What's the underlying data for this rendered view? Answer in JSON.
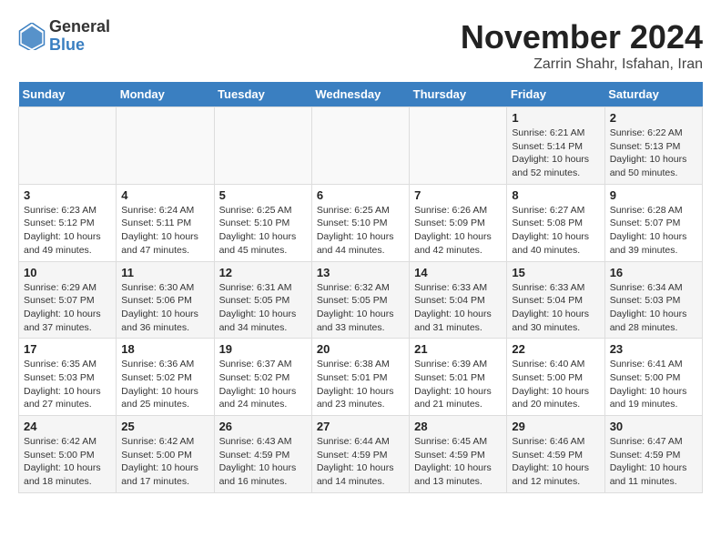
{
  "logo": {
    "general": "General",
    "blue": "Blue"
  },
  "header": {
    "month": "November 2024",
    "location": "Zarrin Shahr, Isfahan, Iran"
  },
  "weekdays": [
    "Sunday",
    "Monday",
    "Tuesday",
    "Wednesday",
    "Thursday",
    "Friday",
    "Saturday"
  ],
  "weeks": [
    [
      {
        "day": "",
        "detail": ""
      },
      {
        "day": "",
        "detail": ""
      },
      {
        "day": "",
        "detail": ""
      },
      {
        "day": "",
        "detail": ""
      },
      {
        "day": "",
        "detail": ""
      },
      {
        "day": "1",
        "detail": "Sunrise: 6:21 AM\nSunset: 5:14 PM\nDaylight: 10 hours\nand 52 minutes."
      },
      {
        "day": "2",
        "detail": "Sunrise: 6:22 AM\nSunset: 5:13 PM\nDaylight: 10 hours\nand 50 minutes."
      }
    ],
    [
      {
        "day": "3",
        "detail": "Sunrise: 6:23 AM\nSunset: 5:12 PM\nDaylight: 10 hours\nand 49 minutes."
      },
      {
        "day": "4",
        "detail": "Sunrise: 6:24 AM\nSunset: 5:11 PM\nDaylight: 10 hours\nand 47 minutes."
      },
      {
        "day": "5",
        "detail": "Sunrise: 6:25 AM\nSunset: 5:10 PM\nDaylight: 10 hours\nand 45 minutes."
      },
      {
        "day": "6",
        "detail": "Sunrise: 6:25 AM\nSunset: 5:10 PM\nDaylight: 10 hours\nand 44 minutes."
      },
      {
        "day": "7",
        "detail": "Sunrise: 6:26 AM\nSunset: 5:09 PM\nDaylight: 10 hours\nand 42 minutes."
      },
      {
        "day": "8",
        "detail": "Sunrise: 6:27 AM\nSunset: 5:08 PM\nDaylight: 10 hours\nand 40 minutes."
      },
      {
        "day": "9",
        "detail": "Sunrise: 6:28 AM\nSunset: 5:07 PM\nDaylight: 10 hours\nand 39 minutes."
      }
    ],
    [
      {
        "day": "10",
        "detail": "Sunrise: 6:29 AM\nSunset: 5:07 PM\nDaylight: 10 hours\nand 37 minutes."
      },
      {
        "day": "11",
        "detail": "Sunrise: 6:30 AM\nSunset: 5:06 PM\nDaylight: 10 hours\nand 36 minutes."
      },
      {
        "day": "12",
        "detail": "Sunrise: 6:31 AM\nSunset: 5:05 PM\nDaylight: 10 hours\nand 34 minutes."
      },
      {
        "day": "13",
        "detail": "Sunrise: 6:32 AM\nSunset: 5:05 PM\nDaylight: 10 hours\nand 33 minutes."
      },
      {
        "day": "14",
        "detail": "Sunrise: 6:33 AM\nSunset: 5:04 PM\nDaylight: 10 hours\nand 31 minutes."
      },
      {
        "day": "15",
        "detail": "Sunrise: 6:33 AM\nSunset: 5:04 PM\nDaylight: 10 hours\nand 30 minutes."
      },
      {
        "day": "16",
        "detail": "Sunrise: 6:34 AM\nSunset: 5:03 PM\nDaylight: 10 hours\nand 28 minutes."
      }
    ],
    [
      {
        "day": "17",
        "detail": "Sunrise: 6:35 AM\nSunset: 5:03 PM\nDaylight: 10 hours\nand 27 minutes."
      },
      {
        "day": "18",
        "detail": "Sunrise: 6:36 AM\nSunset: 5:02 PM\nDaylight: 10 hours\nand 25 minutes."
      },
      {
        "day": "19",
        "detail": "Sunrise: 6:37 AM\nSunset: 5:02 PM\nDaylight: 10 hours\nand 24 minutes."
      },
      {
        "day": "20",
        "detail": "Sunrise: 6:38 AM\nSunset: 5:01 PM\nDaylight: 10 hours\nand 23 minutes."
      },
      {
        "day": "21",
        "detail": "Sunrise: 6:39 AM\nSunset: 5:01 PM\nDaylight: 10 hours\nand 21 minutes."
      },
      {
        "day": "22",
        "detail": "Sunrise: 6:40 AM\nSunset: 5:00 PM\nDaylight: 10 hours\nand 20 minutes."
      },
      {
        "day": "23",
        "detail": "Sunrise: 6:41 AM\nSunset: 5:00 PM\nDaylight: 10 hours\nand 19 minutes."
      }
    ],
    [
      {
        "day": "24",
        "detail": "Sunrise: 6:42 AM\nSunset: 5:00 PM\nDaylight: 10 hours\nand 18 minutes."
      },
      {
        "day": "25",
        "detail": "Sunrise: 6:42 AM\nSunset: 5:00 PM\nDaylight: 10 hours\nand 17 minutes."
      },
      {
        "day": "26",
        "detail": "Sunrise: 6:43 AM\nSunset: 4:59 PM\nDaylight: 10 hours\nand 16 minutes."
      },
      {
        "day": "27",
        "detail": "Sunrise: 6:44 AM\nSunset: 4:59 PM\nDaylight: 10 hours\nand 14 minutes."
      },
      {
        "day": "28",
        "detail": "Sunrise: 6:45 AM\nSunset: 4:59 PM\nDaylight: 10 hours\nand 13 minutes."
      },
      {
        "day": "29",
        "detail": "Sunrise: 6:46 AM\nSunset: 4:59 PM\nDaylight: 10 hours\nand 12 minutes."
      },
      {
        "day": "30",
        "detail": "Sunrise: 6:47 AM\nSunset: 4:59 PM\nDaylight: 10 hours\nand 11 minutes."
      }
    ]
  ]
}
